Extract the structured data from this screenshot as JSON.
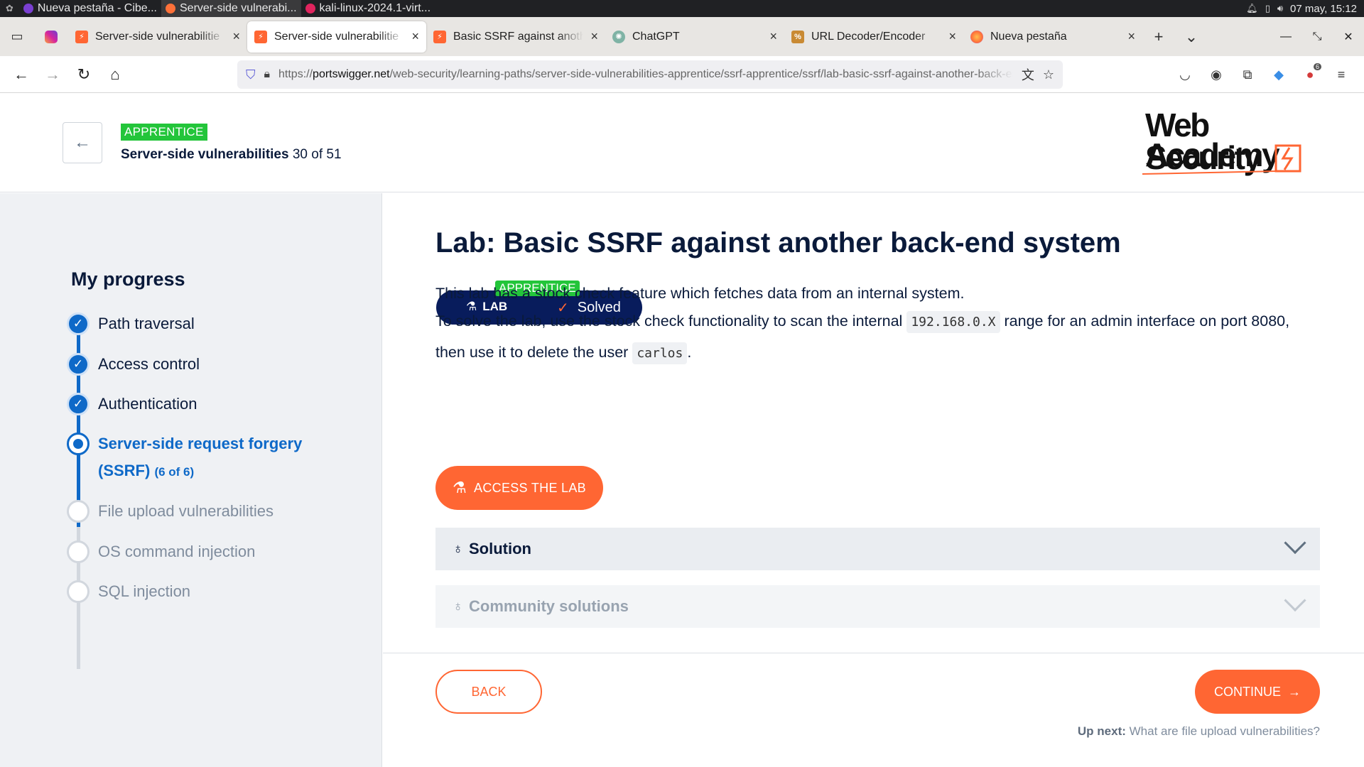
{
  "os": {
    "tasks": [
      {
        "label": "Nueva pestaña - Cibe...",
        "color": "#7a3fd1"
      },
      {
        "label": "Server-side vulnerabi...",
        "color": "#ff7139"
      },
      {
        "label": "kali-linux-2024.1-virt...",
        "color": "#e0245e"
      }
    ],
    "clock": "07 may, 15:12",
    "tray": {
      "bell_icon": "bell-icon",
      "battery_icon": "battery-icon",
      "volume_icon": "volume-icon"
    }
  },
  "browser": {
    "tabs": [
      {
        "title": "Server-side vulnerabilitie",
        "favicon": "burp-icon",
        "color": "#ff6633"
      },
      {
        "title": "Server-side vulnerabilitie",
        "favicon": "burp-icon",
        "color": "#ff6633",
        "active": true
      },
      {
        "title": "Basic SSRF against anoth",
        "favicon": "burp-icon",
        "color": "#ff6633"
      },
      {
        "title": "ChatGPT",
        "favicon": "chatgpt-icon",
        "color": "#7fb3a5"
      },
      {
        "title": "URL Decoder/Encoder",
        "favicon": "decoder-icon",
        "color": "#c98a33"
      },
      {
        "title": "Nueva pestaña",
        "favicon": "firefox-icon",
        "color": "#ff7139"
      }
    ],
    "url_domain": "portswigger.net",
    "url_prefix": "https://",
    "url_path": "/web-security/learning-paths/server-side-vulnerabilities-apprentice/ssrf-apprentice/ssrf/lab-basic-ssrf-against-another-back-end-system",
    "extension_badge": "6"
  },
  "header": {
    "level": "APPRENTICE",
    "path_name": "Server-side vulnerabilities",
    "path_count": "30 of 51",
    "logo_line1": "Web Security",
    "logo_line2": "Academy"
  },
  "sidebar": {
    "heading": "My progress",
    "items": [
      {
        "label": "Path traversal",
        "state": "done"
      },
      {
        "label": "Access control",
        "state": "done"
      },
      {
        "label": "Authentication",
        "state": "done"
      },
      {
        "label_line1": "Server-side request forgery",
        "label_line2": "(SSRF)",
        "sub": "(6 of 6)",
        "state": "current"
      },
      {
        "label": "File upload vulnerabilities",
        "state": "todo"
      },
      {
        "label": "OS command injection",
        "state": "todo"
      },
      {
        "label": "SQL injection",
        "state": "todo"
      }
    ]
  },
  "main": {
    "title": "Lab: Basic SSRF against another back-end system",
    "pill_level": "APPRENTICE",
    "pill_lab": "LAB",
    "pill_status": "Solved",
    "desc1": "This lab has a stock check feature which fetches data from an internal system.",
    "desc2_a": "To solve the lab, use the stock check functionality to scan the internal",
    "desc2_code1": "192.168.0.X",
    "desc2_b": "range for an admin interface on port 8080, then use it to delete the user",
    "desc2_code2": "carlos",
    "desc2_c": ".",
    "access_button": "ACCESS THE LAB",
    "solution_label": "Solution",
    "community_label": "Community solutions",
    "back_button": "BACK",
    "continue_button": "CONTINUE",
    "upnext_label": "Up next:",
    "upnext_title": "What are file upload vulnerabilities?"
  },
  "colors": {
    "accent": "#ff6633",
    "level_green": "#23c53a",
    "progress_blue": "#0e69c8",
    "pill_navy": "#081c5c"
  }
}
